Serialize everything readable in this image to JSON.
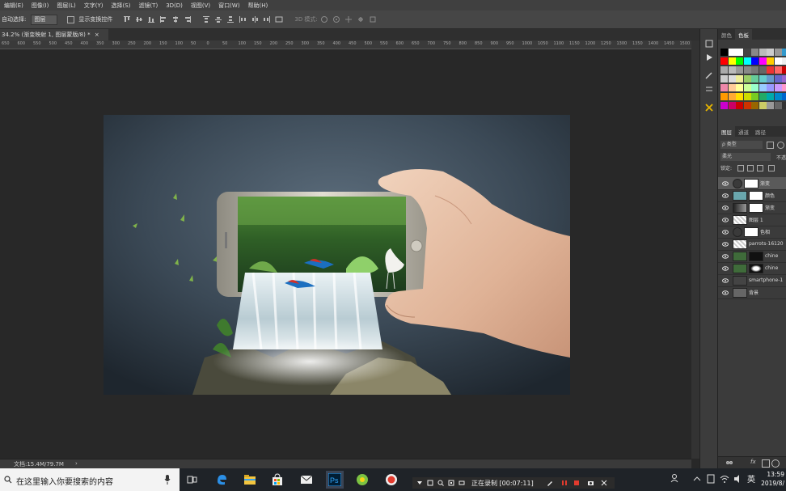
{
  "menu": [
    "编辑(E)",
    "图像(I)",
    "图层(L)",
    "文字(Y)",
    "选择(S)",
    "滤镜(T)",
    "3D(D)",
    "视图(V)",
    "窗口(W)",
    "帮助(H)"
  ],
  "options_bar": {
    "auto_select_label": "自动选择:",
    "auto_select_value": "图层",
    "show_transform_label": "显示变换控件",
    "mode_3d_label": "3D 模式:"
  },
  "document_tab": {
    "title": "34.2% (渐变映射 1, 图层蒙版/8) *",
    "close_glyph": "×"
  },
  "ruler_ticks": [
    "650",
    "600",
    "550",
    "500",
    "450",
    "400",
    "350",
    "300",
    "250",
    "200",
    "150",
    "100",
    "50",
    "0",
    "50",
    "100",
    "150",
    "200",
    "250",
    "300",
    "350",
    "400",
    "450",
    "500",
    "550",
    "600",
    "650",
    "700",
    "750",
    "800",
    "850",
    "900",
    "950",
    "1000",
    "1050",
    "1100",
    "1150",
    "1200",
    "1250",
    "1300",
    "1350",
    "1400",
    "1450",
    "1500",
    "1550",
    "1600",
    "1650",
    "1700",
    "1750",
    "1800",
    "1850",
    "1900",
    "1950",
    "2000",
    "2050",
    "2100",
    "2150",
    "2200",
    "2250",
    "2300",
    "2350",
    "2400",
    "2450",
    "2500",
    "2550",
    "2600",
    "2650",
    "2700",
    "2750",
    "2800",
    "2850",
    "2900",
    "2950",
    "3000",
    "3050",
    "3100",
    "3150",
    "3200",
    "3250",
    "3300",
    "3350",
    "3400",
    "3450",
    "3500",
    "3550",
    "3600",
    "3650",
    "3700"
  ],
  "status_bar": {
    "doc_info": "文档:15.4M/79.7M",
    "arrow_glyph": "›"
  },
  "panels": {
    "color_tabs": [
      "颜色",
      "色板"
    ],
    "layer_tabs": [
      "图层",
      "通道",
      "路径"
    ],
    "filter_label": "ρ 类型",
    "blend_mode": "柔光",
    "opacity_label": "不透",
    "lock_label": "锁定:",
    "layers": [
      {
        "name": "渐变",
        "selected": true,
        "kind": "adjust"
      },
      {
        "name": "颜色",
        "selected": false,
        "kind": "fill"
      },
      {
        "name": "渐变",
        "selected": false,
        "kind": "gradient"
      },
      {
        "name": "图层 1",
        "selected": false,
        "kind": "trans"
      },
      {
        "name": "色相",
        "selected": false,
        "kind": "adjust"
      },
      {
        "name": "parrots-16120",
        "selected": false,
        "kind": "trans"
      },
      {
        "name": "chine",
        "selected": false,
        "kind": "photo-mask-dark"
      },
      {
        "name": "chine",
        "selected": false,
        "kind": "photo-mask-dark2"
      },
      {
        "name": "smartphone-1",
        "selected": false,
        "kind": "phone"
      },
      {
        "name": "背景",
        "selected": false,
        "kind": "bg"
      }
    ],
    "footer_fx": "fx"
  },
  "taskbar": {
    "search_placeholder": "在这里输入你要搜索的内容",
    "recording_text": "正在录制 [00:07:11]",
    "time": "13:59",
    "date": "2019/8/",
    "ime": "英"
  },
  "colors": {
    "app_bg": "#282828",
    "selected_layer": "#5a5a5a",
    "record_red": "#e33b2e"
  }
}
